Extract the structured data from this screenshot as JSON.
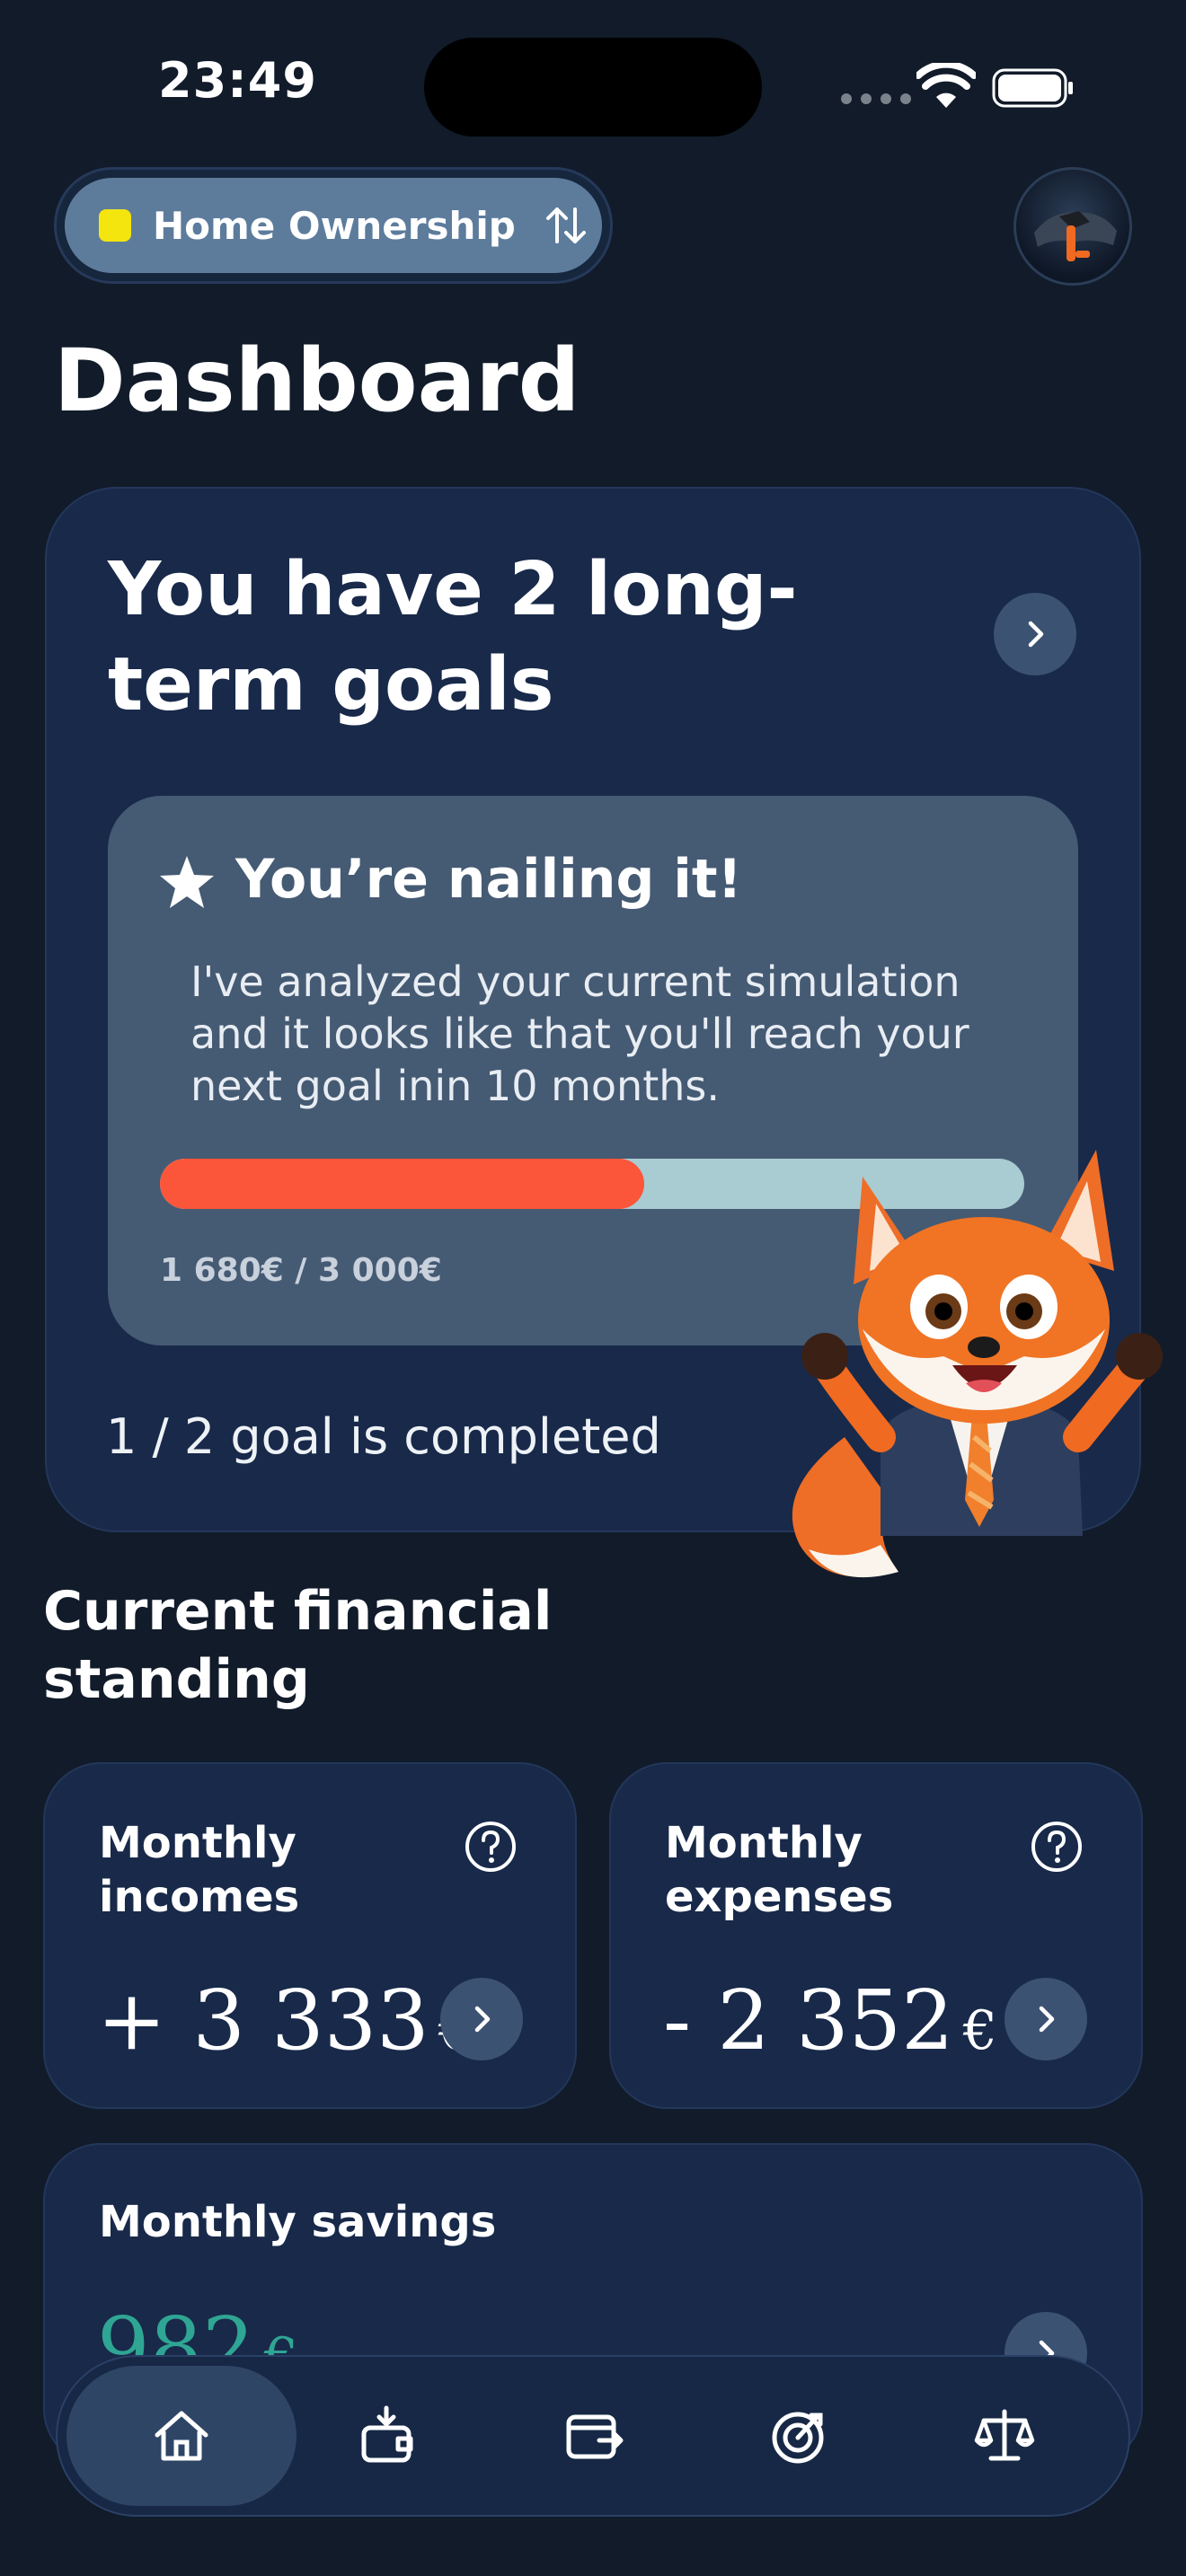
{
  "status_bar": {
    "time": "23:49"
  },
  "home_selector": {
    "label": "Home Ownership",
    "dot_color": "#f4e50f"
  },
  "page_title": "Dashboard",
  "goals_card": {
    "heading": "You have 2 long-term goals",
    "insight": {
      "title": "You’re nailing it!",
      "body": "I've analyzed your current simulation and it looks like that you'll reach your next goal inin 10 months.",
      "progress_fraction": 0.56,
      "progress_text": "1 680€ / 3 000€"
    },
    "completed_text": "1 / 2 goal is completed"
  },
  "section_title": "Current financial standing",
  "income_card": {
    "label": "Monthly incomes",
    "amount": "+ 3 333",
    "currency": "€"
  },
  "expenses_card": {
    "label": "Monthly expenses",
    "amount": "- 2 352",
    "currency": "€"
  },
  "savings_card": {
    "label": "Monthly savings",
    "amount": "982",
    "currency": "€"
  },
  "tabbar": {
    "items": [
      {
        "icon": "home-icon",
        "active": true
      },
      {
        "icon": "wallet-download-icon",
        "active": false
      },
      {
        "icon": "wallet-export-icon",
        "active": false
      },
      {
        "icon": "target-icon",
        "active": false
      },
      {
        "icon": "scales-icon",
        "active": false
      }
    ]
  },
  "colors": {
    "background": "#111b2a",
    "card": "#18294a",
    "progress_fill": "#fb553a",
    "progress_track": "#a9cbd2",
    "savings_amount": "#2fa593"
  }
}
